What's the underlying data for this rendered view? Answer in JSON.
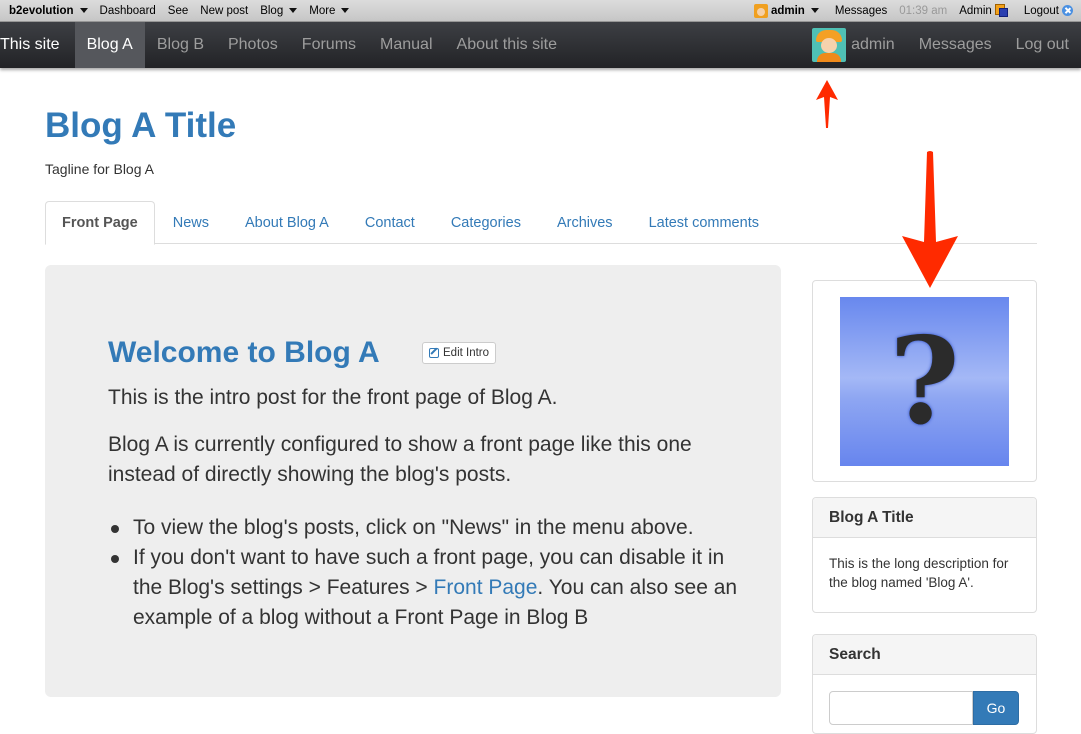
{
  "evobar": {
    "brand": "b2evolution",
    "left_items": [
      "Dashboard",
      "See",
      "New post"
    ],
    "blog_menu": "Blog",
    "more_menu": "More",
    "user_menu": "admin",
    "messages": "Messages",
    "time": "01:39 am",
    "admin": "Admin",
    "logout": "Logout"
  },
  "sitenav": {
    "site": "This site",
    "items": [
      {
        "label": "Blog A",
        "active": true
      },
      {
        "label": "Blog B"
      },
      {
        "label": "Photos"
      },
      {
        "label": "Forums"
      },
      {
        "label": "Manual"
      },
      {
        "label": "About this site"
      }
    ],
    "user": "admin",
    "messages": "Messages",
    "logout": "Log out"
  },
  "header": {
    "title": "Blog A Title",
    "tagline": "Tagline for Blog A"
  },
  "tabs": [
    {
      "label": "Front Page",
      "active": true
    },
    {
      "label": "News"
    },
    {
      "label": "About Blog A"
    },
    {
      "label": "Contact"
    },
    {
      "label": "Categories"
    },
    {
      "label": "Archives"
    },
    {
      "label": "Latest comments"
    }
  ],
  "intro": {
    "title": "Welcome to Blog A",
    "edit_label": "Edit Intro",
    "p1": "This is the intro post for the front page of Blog A.",
    "p2": "Blog A is currently configured to show a front page like this one instead of directly showing the blog's posts.",
    "bullet1": "To view the blog's posts, click on \"News\" in the menu above.",
    "bullet2_pre": "If you don't want to have such a front page, you can disable it in the Blog's settings > Features > ",
    "bullet2_link": "Front Page",
    "bullet2_post": ". You can also see an example of a blog without a Front Page in Blog B"
  },
  "sidebar": {
    "image_alt": "?",
    "desc_title": "Blog A Title",
    "desc_body": "This is the long description for the blog named 'Blog A'.",
    "search_title": "Search",
    "search_value": "",
    "search_button": "Go"
  },
  "colors": {
    "link": "#337ab7",
    "annotation_arrow": "#ff2a00"
  }
}
